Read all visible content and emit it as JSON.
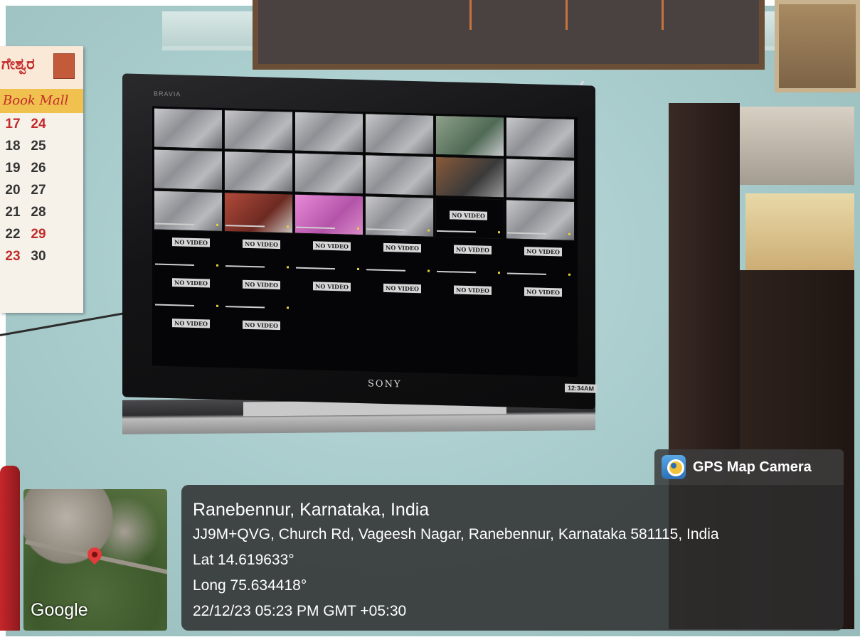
{
  "calendar": {
    "title": "ಗೇಶ್ವರ",
    "banner": "Book Mall",
    "rows": [
      {
        "a": "17",
        "b": "24"
      },
      {
        "a": "18",
        "b": "25"
      },
      {
        "a": "19",
        "b": "26"
      },
      {
        "a": "20",
        "b": "27"
      },
      {
        "a": "21",
        "b": "28"
      },
      {
        "a": "22",
        "b": "29"
      },
      {
        "a": "23",
        "b": "30"
      }
    ]
  },
  "tv": {
    "brand": "BRAVIA",
    "logo": "SONY",
    "no_video_label": "NO VIDEO",
    "clock": "12:34AM"
  },
  "overlay": {
    "app_name": "GPS Map Camera",
    "place": "Ranebennur, Karnataka, India",
    "address": "JJ9M+QVG, Church Rd, Vageesh Nagar, Ranebennur, Karnataka 581115, India",
    "lat": "Lat 14.619633°",
    "long": "Long 75.634418°",
    "datetime": "22/12/23 05:23 PM GMT +05:30",
    "map_provider": "Google"
  },
  "colors": {
    "wall": "#a9cccd",
    "overlay_bg": "#2d2d2d",
    "pin": "#e23b3b"
  }
}
